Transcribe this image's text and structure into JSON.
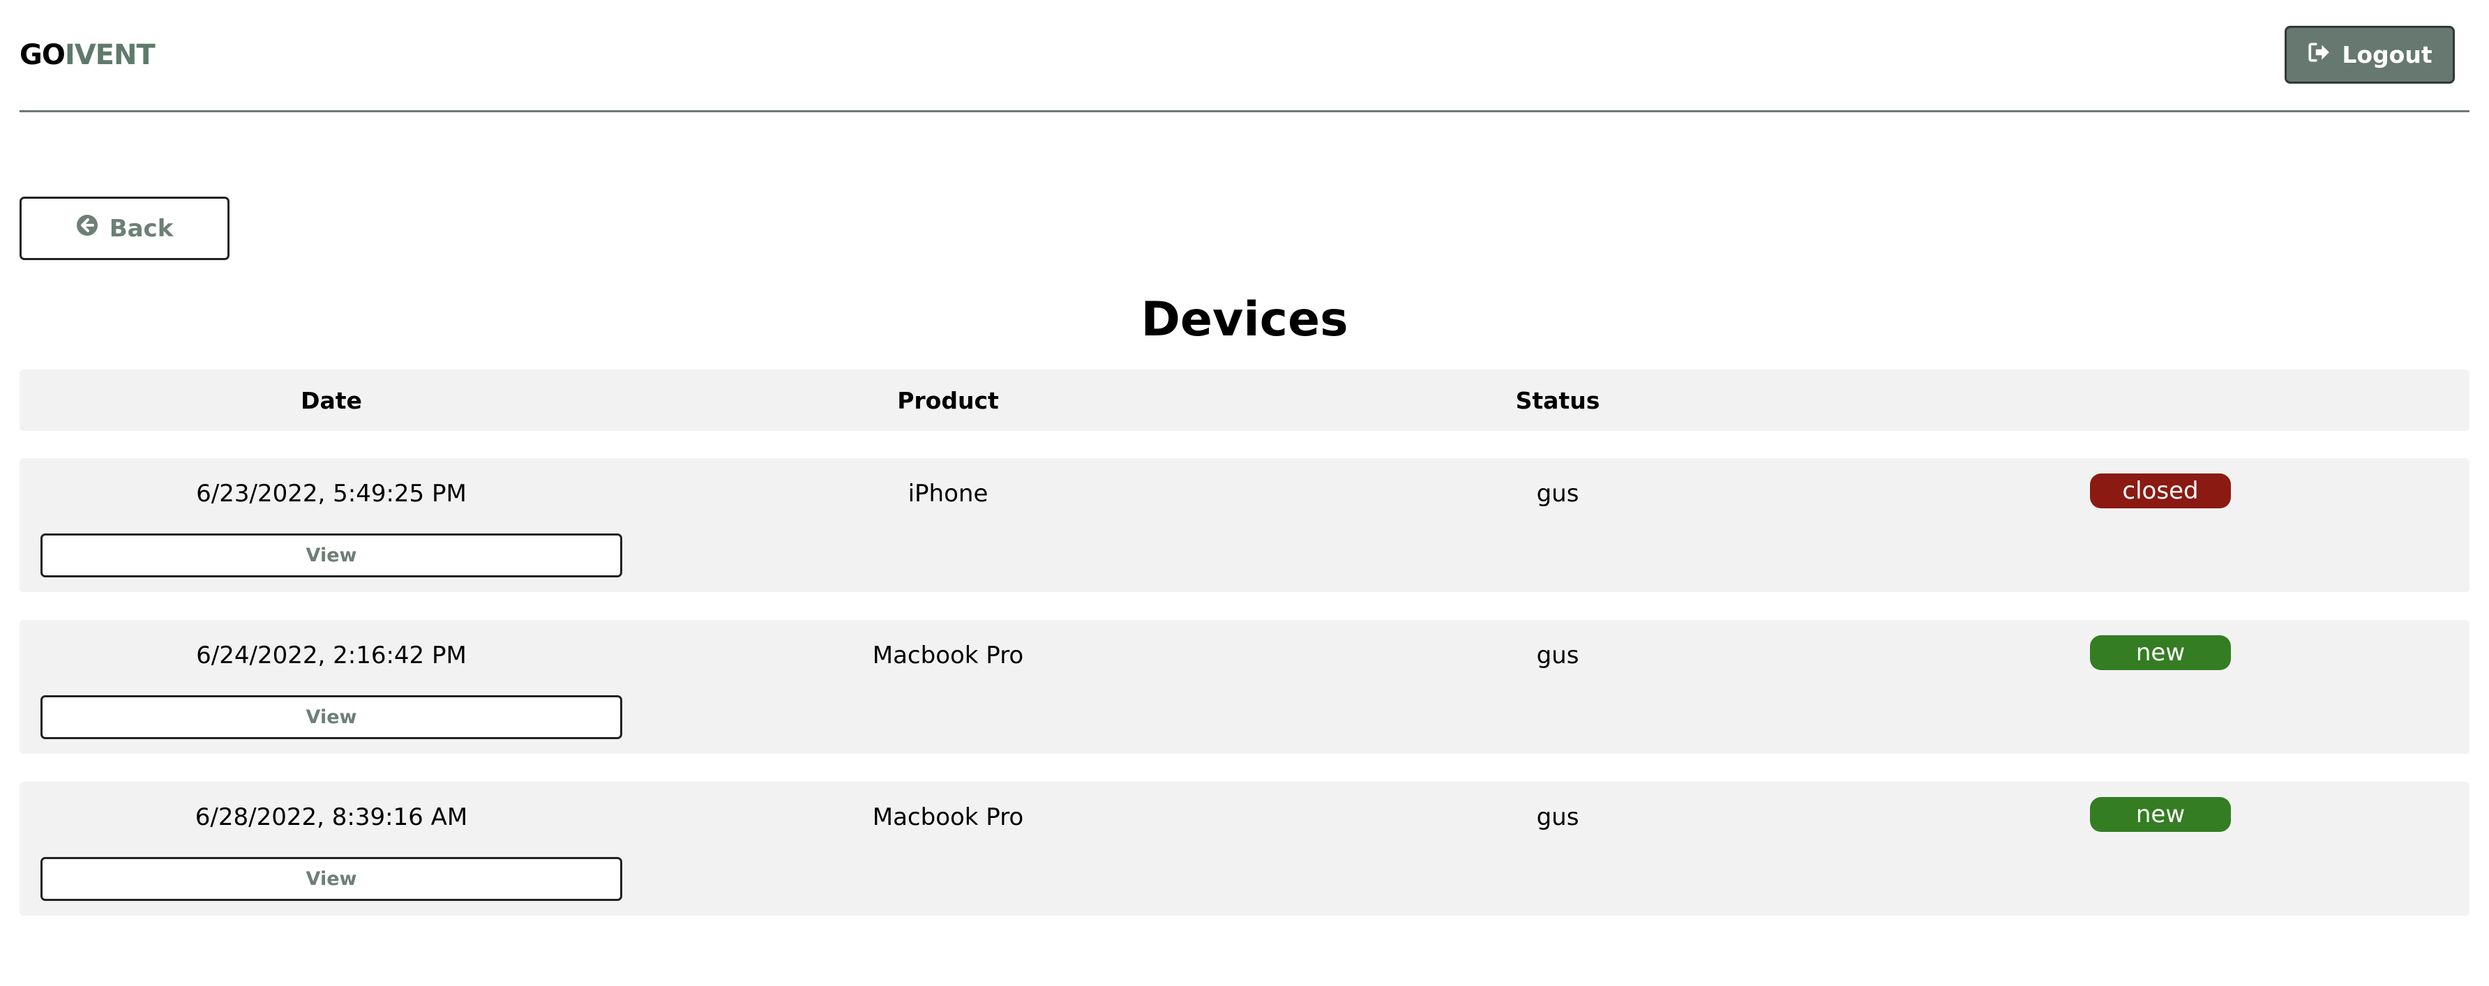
{
  "header": {
    "logo_part1": "GO",
    "logo_part2": "IVENT",
    "logout_label": "Logout"
  },
  "back_label": "Back",
  "page_title": "Devices",
  "table": {
    "columns": [
      "Date",
      "Product",
      "Status"
    ],
    "rows": [
      {
        "date": "6/23/2022, 5:49:25 PM",
        "product": "iPhone",
        "status": "gus",
        "badge": "closed",
        "badge_color": "#8b1a12",
        "view_label": "View"
      },
      {
        "date": "6/24/2022, 2:16:42 PM",
        "product": "Macbook Pro",
        "status": "gus",
        "badge": "new",
        "badge_color": "#347d23",
        "view_label": "View"
      },
      {
        "date": "6/28/2022, 8:39:16 AM",
        "product": "Macbook Pro",
        "status": "gus",
        "badge": "new",
        "badge_color": "#347d23",
        "view_label": "View"
      }
    ]
  },
  "colors": {
    "brand_green": "#5f7a6b",
    "logout_bg": "#66786f",
    "row_bg": "#f2f2f2"
  },
  "icons": {
    "logout": "sign-out-icon",
    "back": "arrow-circle-left-icon"
  }
}
